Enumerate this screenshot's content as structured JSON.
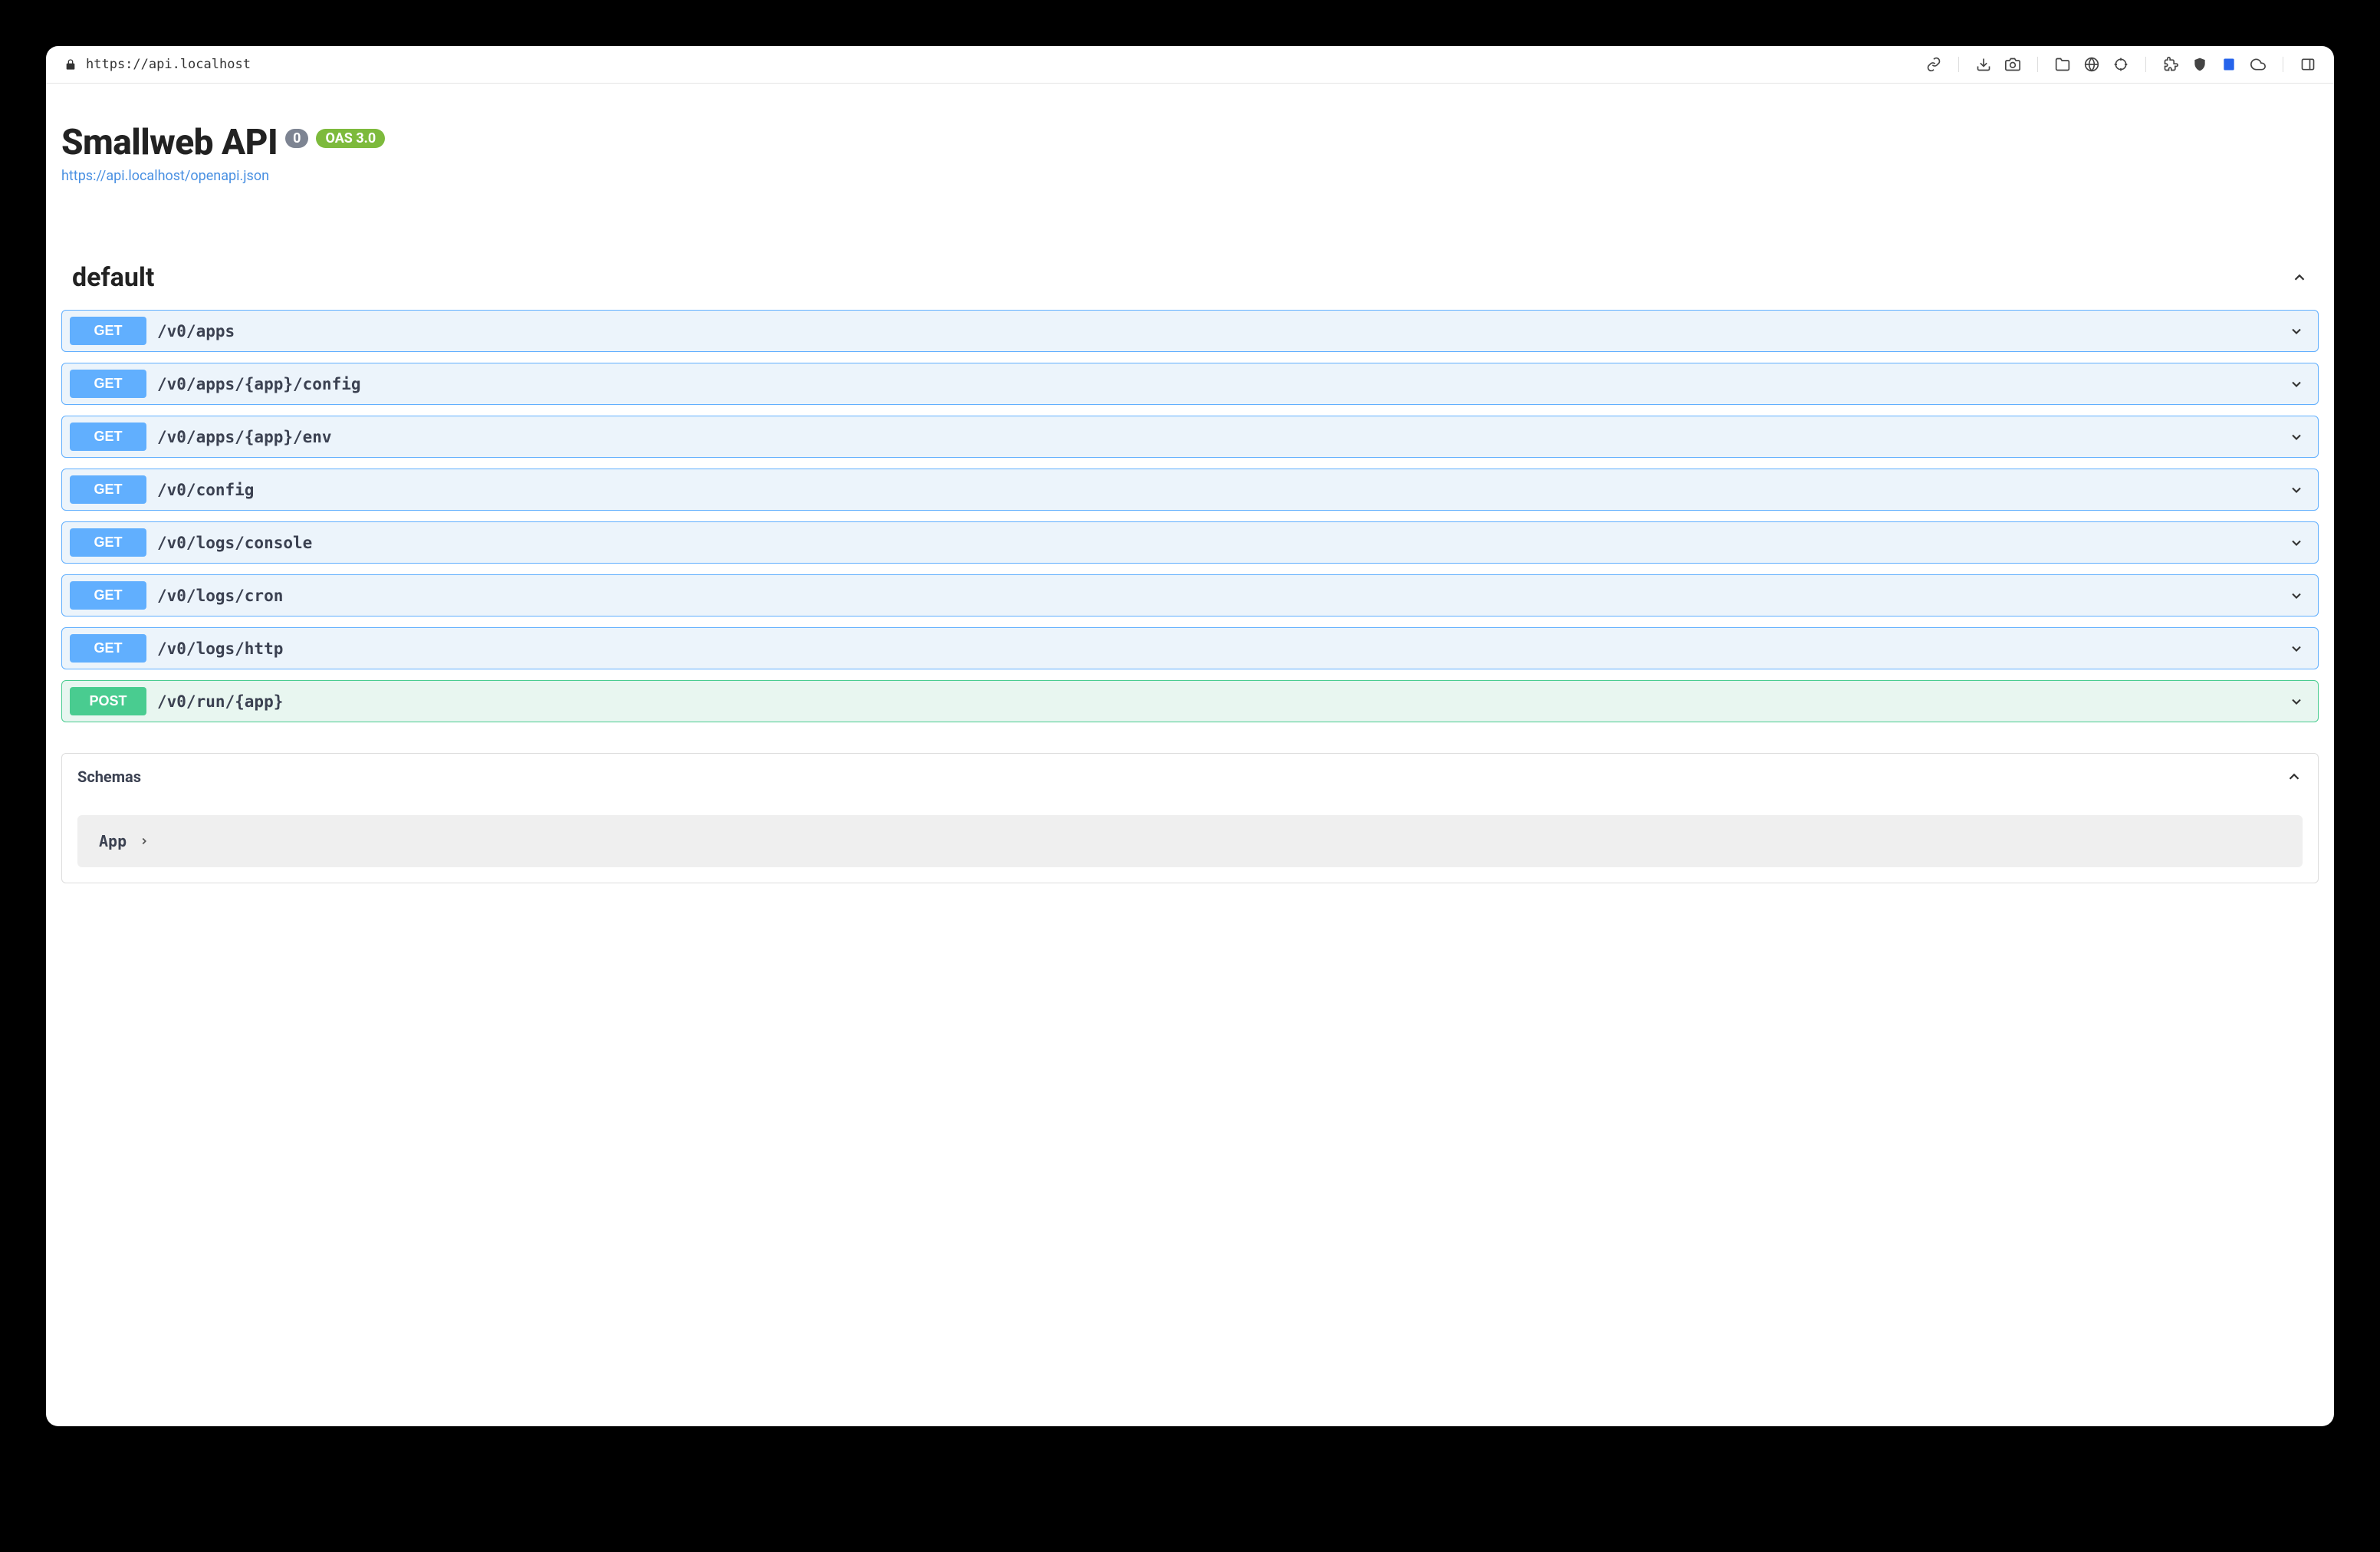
{
  "url": "https://api.localhost",
  "api": {
    "title": "Smallweb API",
    "version": "0",
    "oas_label": "OAS 3.0",
    "spec_url": "https://api.localhost/openapi.json"
  },
  "tag": {
    "name": "default"
  },
  "operations": [
    {
      "method": "GET",
      "path": "/v0/apps"
    },
    {
      "method": "GET",
      "path": "/v0/apps/{app}/config"
    },
    {
      "method": "GET",
      "path": "/v0/apps/{app}/env"
    },
    {
      "method": "GET",
      "path": "/v0/config"
    },
    {
      "method": "GET",
      "path": "/v0/logs/console"
    },
    {
      "method": "GET",
      "path": "/v0/logs/cron"
    },
    {
      "method": "GET",
      "path": "/v0/logs/http"
    },
    {
      "method": "POST",
      "path": "/v0/run/{app}"
    }
  ],
  "schemas": {
    "title": "Schemas",
    "items": [
      {
        "name": "App"
      }
    ]
  }
}
